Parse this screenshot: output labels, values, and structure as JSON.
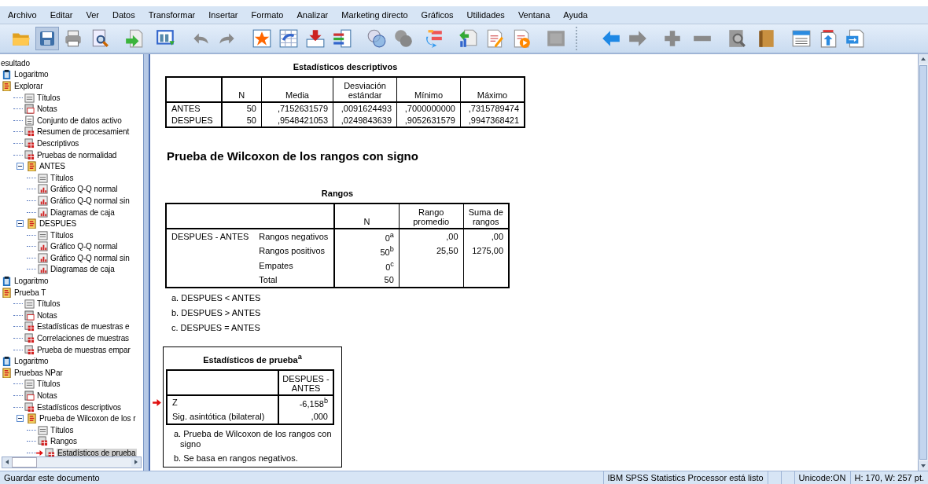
{
  "menu": [
    "Archivo",
    "Editar",
    "Ver",
    "Datos",
    "Transformar",
    "Insertar",
    "Formato",
    "Analizar",
    "Marketing directo",
    "Gráficos",
    "Utilidades",
    "Ventana",
    "Ayuda"
  ],
  "tree": [
    {
      "label": "esultado",
      "kind": "root",
      "selected": false,
      "children": [
        {
          "label": "Logaritmo",
          "kind": "log",
          "selected": false
        },
        {
          "label": "Explorar",
          "kind": "folder",
          "selected": false,
          "children": [
            {
              "label": "Títulos",
              "kind": "title",
              "selected": false
            },
            {
              "label": "Notas",
              "kind": "notes",
              "selected": false
            },
            {
              "label": "Conjunto de datos activo",
              "kind": "doc",
              "selected": false
            },
            {
              "label": "Resumen de procesamient",
              "kind": "table",
              "selected": false
            },
            {
              "label": "Descriptivos",
              "kind": "table",
              "selected": false
            },
            {
              "label": "Pruebas de normalidad",
              "kind": "table",
              "selected": false
            },
            {
              "label": "ANTES",
              "kind": "folder",
              "expanded": true,
              "selected": false,
              "children": [
                {
                  "label": "Títulos",
                  "kind": "title",
                  "selected": false
                },
                {
                  "label": "Gráfico Q-Q normal",
                  "kind": "chart",
                  "selected": false
                },
                {
                  "label": "Gráfico Q-Q normal sin",
                  "kind": "chart",
                  "selected": false
                },
                {
                  "label": "Diagramas de caja",
                  "kind": "chart",
                  "selected": false
                }
              ]
            },
            {
              "label": "DESPUES",
              "kind": "folder",
              "expanded": true,
              "selected": false,
              "children": [
                {
                  "label": "Títulos",
                  "kind": "title",
                  "selected": false
                },
                {
                  "label": "Gráfico Q-Q normal",
                  "kind": "chart",
                  "selected": false
                },
                {
                  "label": "Gráfico Q-Q normal sin",
                  "kind": "chart",
                  "selected": false
                },
                {
                  "label": "Diagramas de caja",
                  "kind": "chart",
                  "selected": false
                }
              ]
            }
          ]
        },
        {
          "label": "Logaritmo",
          "kind": "log",
          "selected": false
        },
        {
          "label": "Prueba T",
          "kind": "folder",
          "selected": false,
          "children": [
            {
              "label": "Títulos",
              "kind": "title",
              "selected": false
            },
            {
              "label": "Notas",
              "kind": "notes",
              "selected": false
            },
            {
              "label": "Estadísticas de muestras e",
              "kind": "table",
              "selected": false
            },
            {
              "label": "Correlaciones de muestras",
              "kind": "table",
              "selected": false
            },
            {
              "label": "Prueba de muestras empar",
              "kind": "table",
              "selected": false
            }
          ]
        },
        {
          "label": "Logaritmo",
          "kind": "log",
          "selected": false
        },
        {
          "label": "Pruebas NPar",
          "kind": "folder",
          "selected": false,
          "children": [
            {
              "label": "Títulos",
              "kind": "title",
              "selected": false
            },
            {
              "label": "Notas",
              "kind": "notes",
              "selected": false
            },
            {
              "label": "Estadísticos descriptivos",
              "kind": "table",
              "selected": false
            },
            {
              "label": "Prueba de Wilcoxon de los r",
              "kind": "folder",
              "expanded": true,
              "selected": false,
              "children": [
                {
                  "label": "Títulos",
                  "kind": "title",
                  "selected": false
                },
                {
                  "label": "Rangos",
                  "kind": "table",
                  "selected": false
                },
                {
                  "label": "Estadísticos de prueba",
                  "kind": "table",
                  "selected": true
                }
              ]
            }
          ]
        }
      ]
    }
  ],
  "output": {
    "descriptives": {
      "title": "Estadísticos descriptivos",
      "columns": [
        "",
        "N",
        "Media",
        "Desviación estándar",
        "Mínimo",
        "Máximo"
      ],
      "rows": [
        [
          "ANTES",
          "50",
          ",7152631579",
          ",0091624493",
          ",7000000000",
          ",7315789474"
        ],
        [
          "DESPUES",
          "50",
          ",9548421053",
          ",0249843639",
          ",9052631579",
          ",9947368421"
        ]
      ]
    },
    "heading": "Prueba de Wilcoxon de los rangos con signo",
    "ranks": {
      "title": "Rangos",
      "columns": [
        "",
        "",
        "N",
        "Rango promedio",
        "Suma de rangos"
      ],
      "rows": [
        [
          "DESPUES - ANTES",
          "Rangos negativos",
          "0$^{a}$",
          ",00",
          ",00"
        ],
        [
          "",
          "Rangos positivos",
          "50$^{b}$",
          "25,50",
          "1275,00"
        ],
        [
          "",
          "Empates",
          "0$^{c}$",
          "",
          ""
        ],
        [
          "",
          "Total",
          "50",
          "",
          ""
        ]
      ],
      "footnotes": [
        "a. DESPUES < ANTES",
        "b. DESPUES > ANTES",
        "c. DESPUES = ANTES"
      ]
    },
    "test": {
      "title": "Estadísticos de prueba$^{a}$",
      "columns": [
        "",
        "DESPUES - ANTES"
      ],
      "rows": [
        [
          "Z",
          "-6,158$^{b}$"
        ],
        [
          "Sig. asintótica (bilateral)",
          ",000"
        ]
      ],
      "footnotes": [
        "a. Prueba de Wilcoxon de los rangos con signo",
        "b. Se basa en rangos negativos."
      ]
    }
  },
  "status_bar": {
    "message": "Guardar este documento",
    "processor": "IBM SPSS Statistics Processor está listo",
    "unicode": "Unicode:ON",
    "size": "H: 170, W: 257 pt."
  }
}
